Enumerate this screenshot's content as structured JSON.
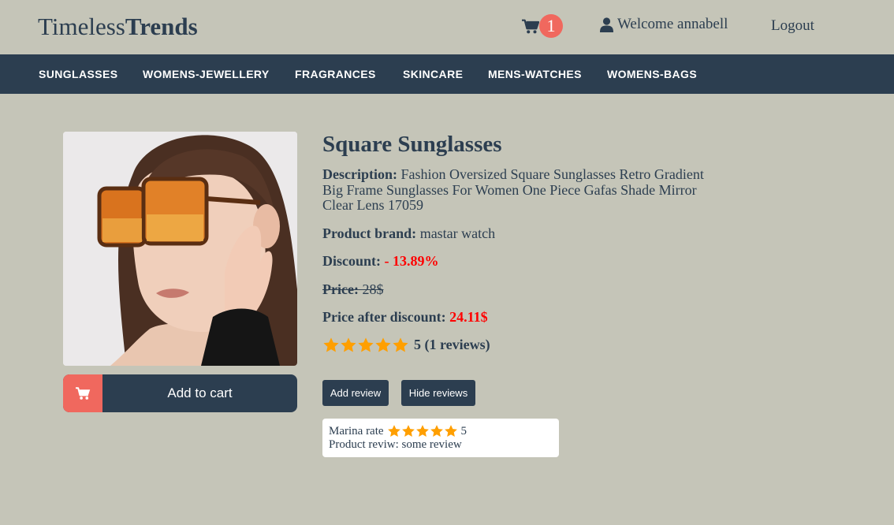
{
  "header": {
    "logo_light": "Timeless",
    "logo_bold": "Trends",
    "cart_count": "1",
    "welcome_text": "Welcome annabell",
    "logout_label": "Logout"
  },
  "nav": {
    "items": [
      {
        "label": "SUNGLASSES"
      },
      {
        "label": "WOMENS-JEWELLERY"
      },
      {
        "label": "FRAGRANCES"
      },
      {
        "label": "SKINCARE"
      },
      {
        "label": "MENS-WATCHES"
      },
      {
        "label": "WOMENS-BAGS"
      }
    ]
  },
  "product": {
    "title": "Square Sunglasses",
    "description_label": "Description:",
    "description": "Fashion Oversized Square Sunglasses Retro Gradient Big Frame Sunglasses For Women One Piece Gafas Shade Mirror Clear Lens 17059",
    "brand_label": "Product brand:",
    "brand": "mastar watch",
    "discount_label": "Discount:",
    "discount": "- 13.89%",
    "price_label": "Price:",
    "price": "28$",
    "price_after_label": "Price after discount:",
    "price_after": "24.11$",
    "rating_value": 5,
    "rating_text": "5 (1 reviews)",
    "add_to_cart_label": "Add to cart"
  },
  "actions": {
    "add_review_label": "Add review",
    "hide_reviews_label": "Hide reviews"
  },
  "reviews": [
    {
      "rate_prefix": "Marina rate",
      "rating": 5,
      "rating_text": "5",
      "text": "Product reviw: some review"
    }
  ],
  "colors": {
    "background": "#c5c5b8",
    "navy": "#2c3e50",
    "accent": "#f0685e",
    "star": "#ff9f00",
    "discount_red": "#ff0000"
  },
  "icons": {
    "cart": "shopping-cart-icon",
    "user": "user-icon",
    "star": "star-icon"
  }
}
